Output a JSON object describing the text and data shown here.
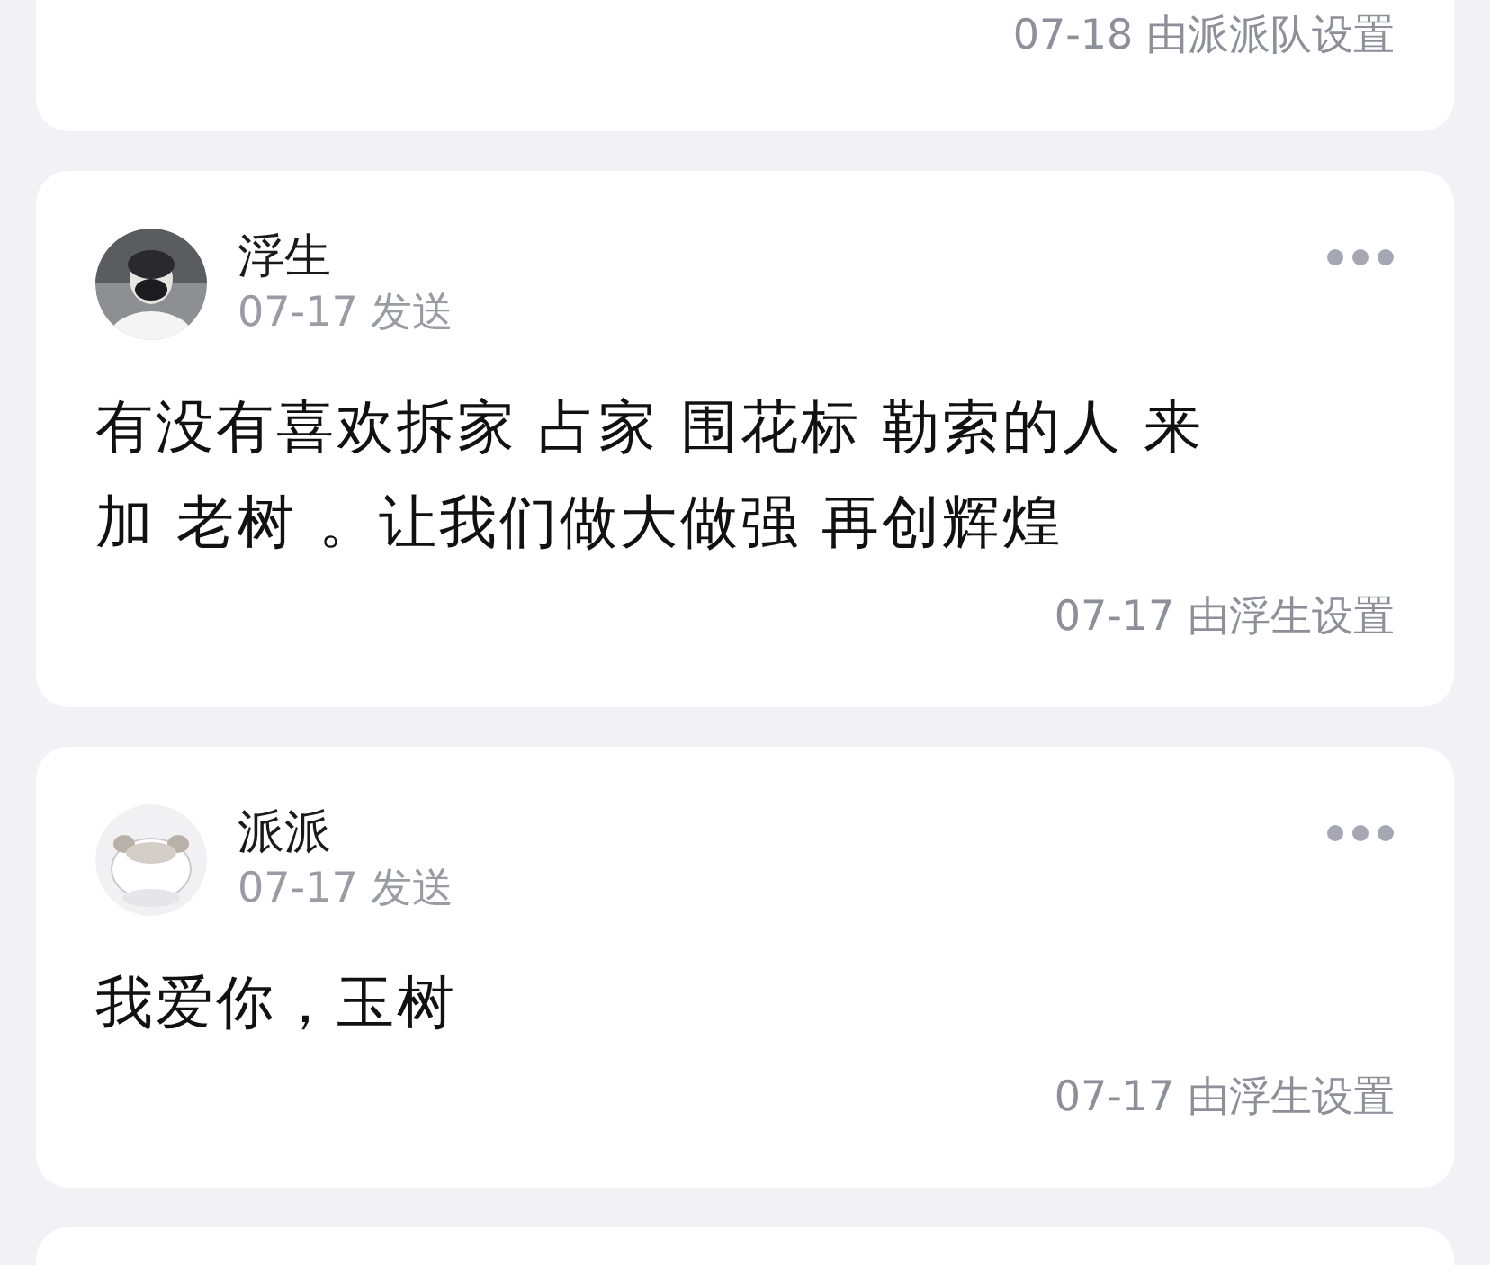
{
  "top_card": {
    "footer": "07-18 由派派队设置"
  },
  "posts": [
    {
      "name": "浮生",
      "time": "07-17 发送",
      "text": "有没有喜欢拆家 占家 围花标 勒索的人 来加 老树 。让我们做大做强 再创辉煌",
      "footer": "07-17 由浮生设置"
    },
    {
      "name": "派派",
      "time": "07-17 发送",
      "text": "我爱你，玉树",
      "footer": "07-17 由浮生设置"
    }
  ]
}
